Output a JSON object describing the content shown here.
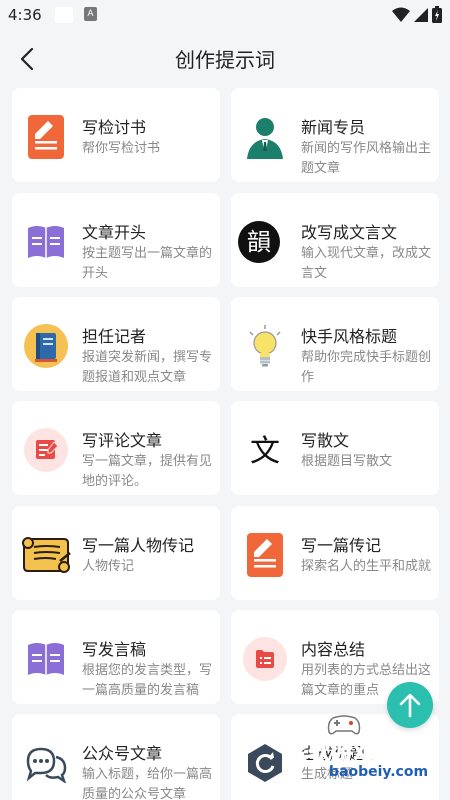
{
  "status": {
    "time": "4:36",
    "a_badge": "A"
  },
  "header": {
    "title": "创作提示词"
  },
  "cards": [
    {
      "title": "写检讨书",
      "desc": "帮你写检讨书",
      "icon": "document-icon"
    },
    {
      "title": "新闻专员",
      "desc": "新闻的写作风格输出主题文章",
      "icon": "reporter-icon"
    },
    {
      "title": "文章开头",
      "desc": "按主题写出一篇文章的开头",
      "icon": "book-icon"
    },
    {
      "title": "改写成文言文",
      "desc": "输入现代文章，改成文言文",
      "icon": "classical-char-icon",
      "glyph": "韻"
    },
    {
      "title": "担任记者",
      "desc": "报道突发新闻，撰写专题报道和观点文章",
      "icon": "notebook-icon"
    },
    {
      "title": "快手风格标题",
      "desc": "帮助你完成快手标题创作",
      "icon": "lightbulb-icon"
    },
    {
      "title": "写评论文章",
      "desc": "写一篇文章，提供有见地的评论。",
      "icon": "comment-icon"
    },
    {
      "title": "写散文",
      "desc": "根据题目写散文",
      "icon": "prose-char-icon",
      "glyph": "文"
    },
    {
      "title": "写一篇人物传记",
      "desc": "人物传记",
      "icon": "scroll-icon"
    },
    {
      "title": "写一篇传记",
      "desc": "探索名人的生平和成就",
      "icon": "document-icon"
    },
    {
      "title": "写发言稿",
      "desc": "根据您的发言类型，写一篇高质量的发言稿",
      "icon": "book-icon"
    },
    {
      "title": "内容总结",
      "desc": "用列表的方式总结出这篇文章的重点",
      "icon": "summary-icon"
    },
    {
      "title": "公众号文章",
      "desc": "输入标题，给你一篇高质量的公众号文章",
      "icon": "chat-bubbles-icon"
    },
    {
      "title": "生成标题",
      "desc": "生成标题",
      "icon": "refresh-icon"
    }
  ],
  "watermark": {
    "text": "宝软游戏网",
    "url": "baobeiy.com"
  },
  "colors": {
    "accent": "#2bbfb0",
    "orange": "#f0683a",
    "purple": "#8b6fd6"
  }
}
